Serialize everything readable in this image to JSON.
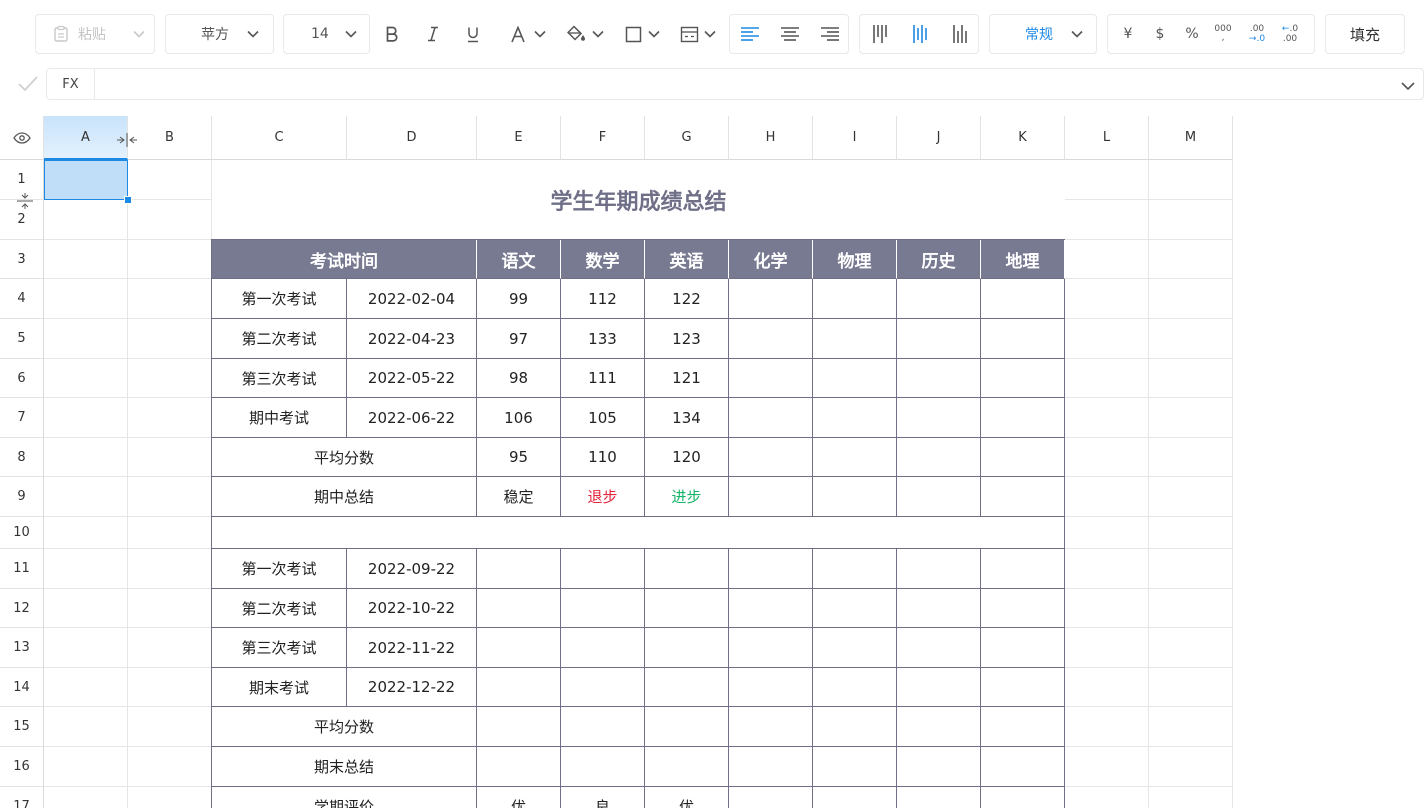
{
  "toolbar": {
    "paste_label": "粘贴",
    "font_family": "苹方",
    "font_size": "14",
    "bold_label": "B",
    "italic_label": "I",
    "underline_label": "U",
    "font_color_label": "A",
    "number_format": "常规",
    "currency_cny": "¥",
    "currency_usd": "$",
    "percent": "%",
    "thousands": "000",
    "inc_decimal": ".00",
    "dec_decimal": ".00",
    "fill_label": "填充",
    "accent_color": "#1e88e5"
  },
  "formula_bar": {
    "fx_label": "FX",
    "value": ""
  },
  "grid": {
    "columns": [
      "A",
      "B",
      "C",
      "D",
      "E",
      "F",
      "G",
      "H",
      "I",
      "J",
      "K",
      "L",
      "M"
    ],
    "rows": [
      "1",
      "2",
      "3",
      "4",
      "5",
      "6",
      "7",
      "8",
      "9",
      "10",
      "11",
      "12",
      "13",
      "14",
      "15",
      "16",
      "17"
    ],
    "active_column": "A",
    "active_row": "1"
  },
  "sheet": {
    "title": "学生年期成绩总结",
    "headers": [
      "考试时间",
      "语文",
      "数学",
      "英语",
      "化学",
      "物理",
      "历史",
      "地理"
    ],
    "exams_first_half": [
      {
        "name": "第一次考试",
        "date": "2022-02-04",
        "scores": [
          "99",
          "112",
          "122"
        ]
      },
      {
        "name": "第二次考试",
        "date": "2022-04-23",
        "scores": [
          "97",
          "133",
          "123"
        ]
      },
      {
        "name": "第三次考试",
        "date": "2022-05-22",
        "scores": [
          "98",
          "111",
          "121"
        ]
      },
      {
        "name": "期中考试",
        "date": "2022-06-22",
        "scores": [
          "106",
          "105",
          "134"
        ]
      }
    ],
    "avg_label": "平均分数",
    "avg_first": [
      "95",
      "110",
      "120"
    ],
    "midterm_summary_label": "期中总结",
    "midterm_summary": [
      "稳定",
      "退步",
      "进步"
    ],
    "exams_second_half": [
      {
        "name": "第一次考试",
        "date": "2022-09-22"
      },
      {
        "name": "第二次考试",
        "date": "2022-10-22"
      },
      {
        "name": "第三次考试",
        "date": "2022-11-22"
      },
      {
        "name": "期末考试",
        "date": "2022-12-22"
      }
    ],
    "final_summary_label": "期末总结",
    "semester_eval_label": "学期评价",
    "semester_eval": [
      "优",
      "良",
      "优"
    ],
    "header_color": "#787a92",
    "title_color": "#6f7088",
    "regress_color": "#e5253b",
    "progress_color": "#16b569"
  }
}
